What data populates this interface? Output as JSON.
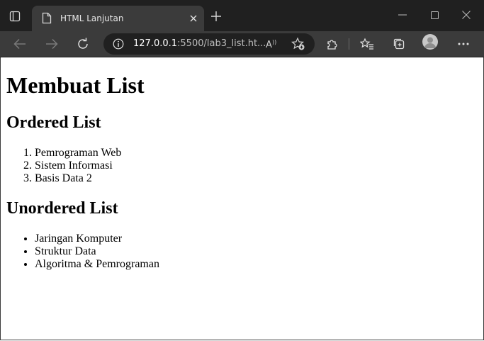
{
  "browser": {
    "tab": {
      "title": "HTML Lanjutan"
    },
    "address": {
      "host": "127.0.0.1",
      "rest": ":5500/lab3_list.ht..."
    }
  },
  "icons": {
    "tab_actions": "tab-actions-icon",
    "page": "page-icon",
    "close": "close-icon",
    "new_tab": "plus-icon",
    "back": "back-arrow-icon",
    "forward": "forward-arrow-icon",
    "refresh": "refresh-icon",
    "info": "info-icon",
    "read_aloud": "read-aloud-icon",
    "favorite_add": "favorite-add-icon",
    "extensions": "puzzle-icon",
    "favorites": "favorites-icon",
    "collections": "collections-icon",
    "profile": "profile-icon",
    "more": "more-icon"
  },
  "page": {
    "h1": "Membuat List",
    "ordered": {
      "heading": "Ordered List",
      "items": [
        "Pemrograman Web",
        "Sistem Informasi",
        "Basis Data 2"
      ]
    },
    "unordered": {
      "heading": "Unordered List",
      "items": [
        "Jaringan Komputer",
        "Struktur Data",
        "Algoritma & Pemrograman"
      ]
    }
  }
}
